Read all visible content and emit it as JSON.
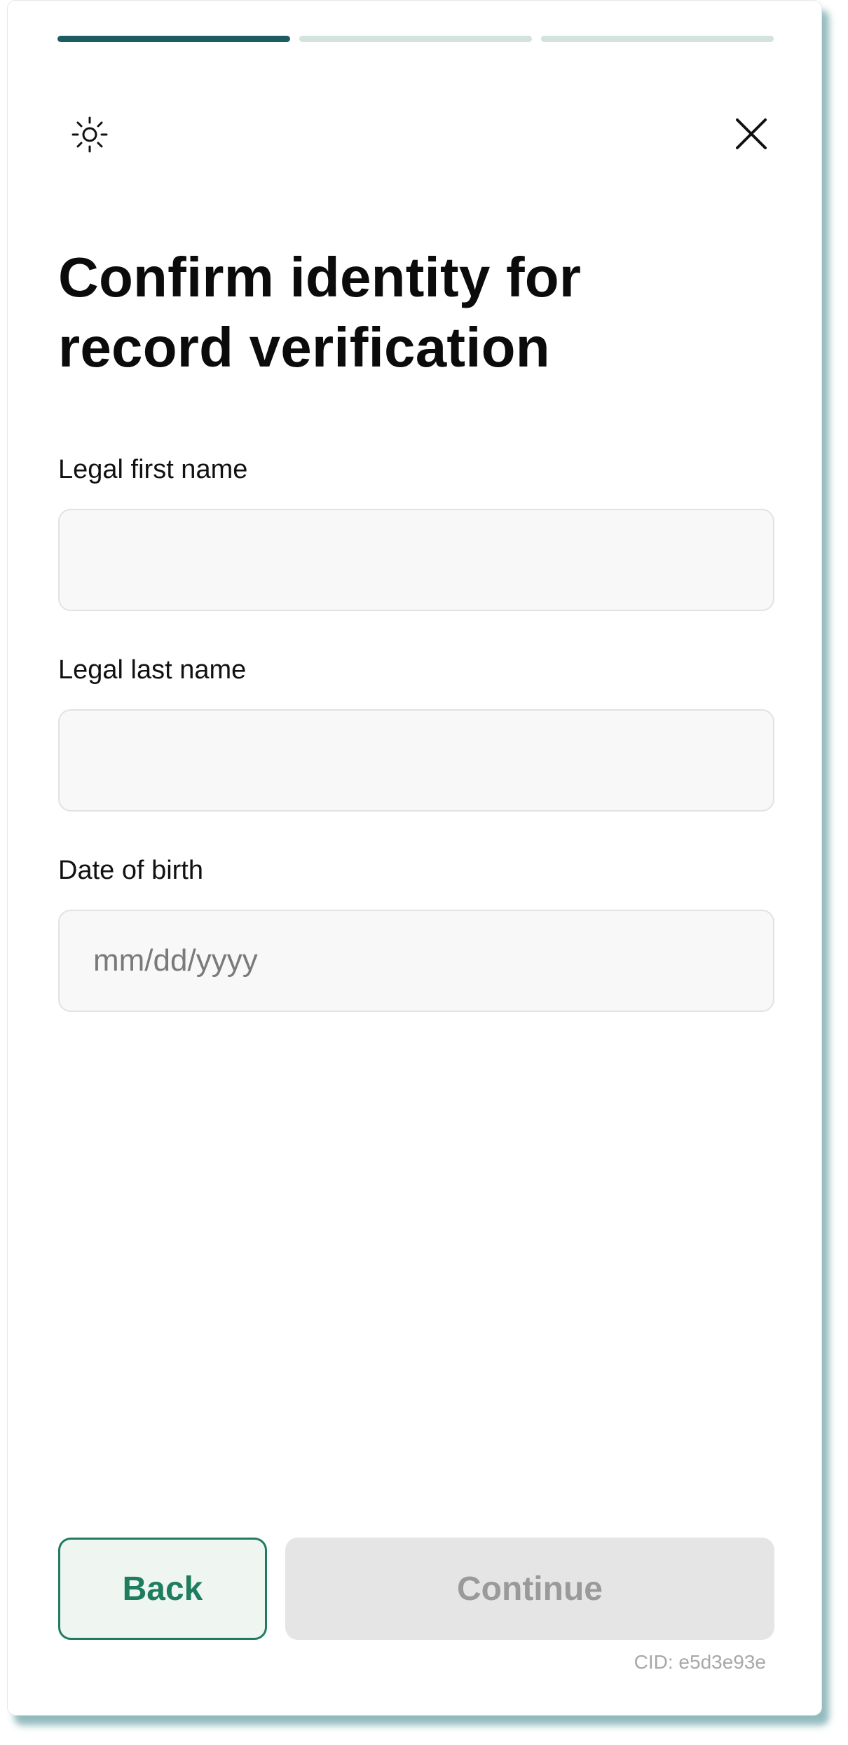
{
  "progress": {
    "steps_total": 3,
    "steps_completed": 1,
    "active_color": "#1d5c63",
    "inactive_color": "#d3e2da"
  },
  "header": {
    "theme_icon": "sun-icon",
    "close_icon": "close-icon"
  },
  "title": {
    "line1": "Confirm identity for",
    "line2": "record verification"
  },
  "form": {
    "first_name": {
      "label": "Legal first name",
      "value": "",
      "placeholder": ""
    },
    "last_name": {
      "label": "Legal last name",
      "value": "",
      "placeholder": ""
    },
    "dob": {
      "label": "Date of birth",
      "value": "",
      "placeholder": "mm/dd/yyyy"
    }
  },
  "actions": {
    "back_label": "Back",
    "continue_label": "Continue",
    "accent_color": "#1e7d5f"
  },
  "footer": {
    "cid": "CID: e5d3e93e"
  }
}
